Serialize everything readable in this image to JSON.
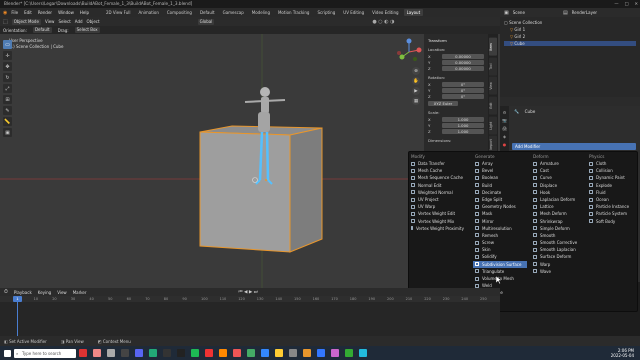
{
  "window": {
    "title": "Blender* [C:\\Users\\Legar\\Downloads\\BuildABot_Female_1_3\\BuildABot_Female_1_3.blend]",
    "controls": [
      "—",
      "□",
      "✕"
    ]
  },
  "menubar": {
    "menus": [
      "File",
      "Edit",
      "Render",
      "Window",
      "Help"
    ],
    "workspaces": [
      "2D View Full",
      "Animation",
      "Compositing",
      "Default",
      "Gamescap",
      "Modeling",
      "Motion Tracking",
      "Scripting",
      "UV Editing",
      "Video Editing",
      "Layout"
    ],
    "active_workspace": "Layout",
    "scene": "Scene",
    "view_layer": "RenderLayer"
  },
  "viewport_header": {
    "mode": "Object Mode",
    "menus": [
      "View",
      "Select",
      "Add",
      "Object"
    ],
    "transform_orientation": "Global"
  },
  "viewport_subheader": {
    "orientation_label": "Orientation:",
    "orientation_value": "Default",
    "drag_label": "Drag:",
    "drag_value": "Select Box"
  },
  "viewport_info": {
    "line1": "User Perspective",
    "line2": "(1) Scene Collection | Cube"
  },
  "npanel": {
    "section": "Transform",
    "location_label": "Location:",
    "location": [
      "0.00000",
      "0.00000",
      "0.00000"
    ],
    "rotation_label": "Rotation:",
    "rotation": [
      "0°",
      "0°",
      "0°"
    ],
    "rotation_mode": "XYZ Euler",
    "scale_label": "Scale:",
    "scale": [
      "1.000",
      "1.000",
      "1.000"
    ],
    "dimensions_label": "Dimensions:",
    "axes": [
      "X",
      "Y",
      "Z"
    ],
    "tabs": [
      "Item",
      "Tool",
      "View",
      "Edit",
      "Light",
      "Import"
    ]
  },
  "outliner": {
    "title": "Scene",
    "rows": [
      "Scene Collection",
      "Girl 1",
      "Girl 2",
      "Cube"
    ]
  },
  "properties": {
    "object_name": "Cube",
    "add_modifier_label": "Add Modifier"
  },
  "modifier_menu": {
    "columns": [
      {
        "heading": "Modify",
        "items": [
          "Data Transfer",
          "Mesh Cache",
          "Mesh Sequence Cache",
          "Normal Edit",
          "Weighted Normal",
          "UV Project",
          "UV Warp",
          "Vertex Weight Edit",
          "Vertex Weight Mix",
          "Vertex Weight Proximity"
        ]
      },
      {
        "heading": "Generate",
        "items": [
          "Array",
          "Bevel",
          "Boolean",
          "Build",
          "Decimate",
          "Edge Split",
          "Geometry Nodes",
          "Mask",
          "Mirror",
          "Multiresolution",
          "Remesh",
          "Screw",
          "Skin",
          "Solidify",
          "Subdivision Surface",
          "Triangulate",
          "Volume to Mesh",
          "Weld",
          "Wireframe"
        ]
      },
      {
        "heading": "Deform",
        "items": [
          "Armature",
          "Cast",
          "Curve",
          "Displace",
          "Hook",
          "Laplacian Deform",
          "Lattice",
          "Mesh Deform",
          "Shrinkwrap",
          "Simple Deform",
          "Smooth",
          "Smooth Corrective",
          "Smooth Laplacian",
          "Surface Deform",
          "Warp",
          "Wave"
        ]
      },
      {
        "heading": "Physics",
        "items": [
          "Cloth",
          "Collision",
          "Dynamic Paint",
          "Explode",
          "Fluid",
          "Ocean",
          "Particle Instance",
          "Particle System",
          "Soft Body"
        ]
      }
    ],
    "highlighted": "Subdivision Surface"
  },
  "timeline": {
    "menus": [
      "Playback",
      "Keying",
      "View",
      "Marker"
    ],
    "current_frame": "1",
    "ticks": [
      "0",
      "10",
      "20",
      "30",
      "40",
      "50",
      "60",
      "70",
      "80",
      "90",
      "100",
      "110",
      "120",
      "130",
      "140",
      "150",
      "160",
      "170",
      "180",
      "190",
      "200",
      "210",
      "220",
      "230",
      "240",
      "250"
    ]
  },
  "statusbar": {
    "items": [
      "Set Active Modifier",
      "Pan View",
      "Context Menu"
    ]
  },
  "taskbar": {
    "search_placeholder": "Type here to search",
    "time": "2:06 PM",
    "date": "2022-05-04"
  },
  "colors": {
    "accent": "#4772b3",
    "selection_orange": "#e8962c",
    "viewport_bg": "#3a3a3a"
  }
}
